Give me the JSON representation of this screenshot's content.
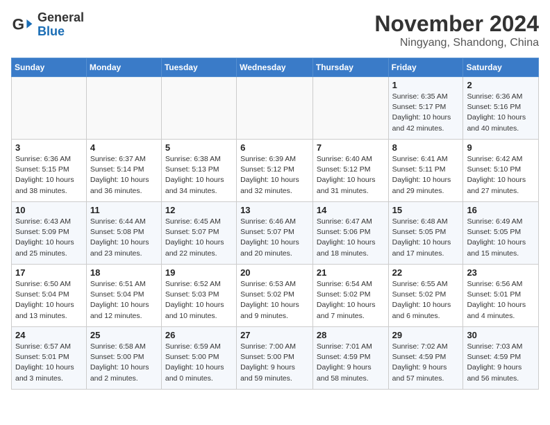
{
  "header": {
    "logo_general": "General",
    "logo_blue": "Blue",
    "month_title": "November 2024",
    "location": "Ningyang, Shandong, China"
  },
  "weekdays": [
    "Sunday",
    "Monday",
    "Tuesday",
    "Wednesday",
    "Thursday",
    "Friday",
    "Saturday"
  ],
  "weeks": [
    [
      {
        "day": "",
        "info": ""
      },
      {
        "day": "",
        "info": ""
      },
      {
        "day": "",
        "info": ""
      },
      {
        "day": "",
        "info": ""
      },
      {
        "day": "",
        "info": ""
      },
      {
        "day": "1",
        "info": "Sunrise: 6:35 AM\nSunset: 5:17 PM\nDaylight: 10 hours and 42 minutes."
      },
      {
        "day": "2",
        "info": "Sunrise: 6:36 AM\nSunset: 5:16 PM\nDaylight: 10 hours and 40 minutes."
      }
    ],
    [
      {
        "day": "3",
        "info": "Sunrise: 6:36 AM\nSunset: 5:15 PM\nDaylight: 10 hours and 38 minutes."
      },
      {
        "day": "4",
        "info": "Sunrise: 6:37 AM\nSunset: 5:14 PM\nDaylight: 10 hours and 36 minutes."
      },
      {
        "day": "5",
        "info": "Sunrise: 6:38 AM\nSunset: 5:13 PM\nDaylight: 10 hours and 34 minutes."
      },
      {
        "day": "6",
        "info": "Sunrise: 6:39 AM\nSunset: 5:12 PM\nDaylight: 10 hours and 32 minutes."
      },
      {
        "day": "7",
        "info": "Sunrise: 6:40 AM\nSunset: 5:12 PM\nDaylight: 10 hours and 31 minutes."
      },
      {
        "day": "8",
        "info": "Sunrise: 6:41 AM\nSunset: 5:11 PM\nDaylight: 10 hours and 29 minutes."
      },
      {
        "day": "9",
        "info": "Sunrise: 6:42 AM\nSunset: 5:10 PM\nDaylight: 10 hours and 27 minutes."
      }
    ],
    [
      {
        "day": "10",
        "info": "Sunrise: 6:43 AM\nSunset: 5:09 PM\nDaylight: 10 hours and 25 minutes."
      },
      {
        "day": "11",
        "info": "Sunrise: 6:44 AM\nSunset: 5:08 PM\nDaylight: 10 hours and 23 minutes."
      },
      {
        "day": "12",
        "info": "Sunrise: 6:45 AM\nSunset: 5:07 PM\nDaylight: 10 hours and 22 minutes."
      },
      {
        "day": "13",
        "info": "Sunrise: 6:46 AM\nSunset: 5:07 PM\nDaylight: 10 hours and 20 minutes."
      },
      {
        "day": "14",
        "info": "Sunrise: 6:47 AM\nSunset: 5:06 PM\nDaylight: 10 hours and 18 minutes."
      },
      {
        "day": "15",
        "info": "Sunrise: 6:48 AM\nSunset: 5:05 PM\nDaylight: 10 hours and 17 minutes."
      },
      {
        "day": "16",
        "info": "Sunrise: 6:49 AM\nSunset: 5:05 PM\nDaylight: 10 hours and 15 minutes."
      }
    ],
    [
      {
        "day": "17",
        "info": "Sunrise: 6:50 AM\nSunset: 5:04 PM\nDaylight: 10 hours and 13 minutes."
      },
      {
        "day": "18",
        "info": "Sunrise: 6:51 AM\nSunset: 5:04 PM\nDaylight: 10 hours and 12 minutes."
      },
      {
        "day": "19",
        "info": "Sunrise: 6:52 AM\nSunset: 5:03 PM\nDaylight: 10 hours and 10 minutes."
      },
      {
        "day": "20",
        "info": "Sunrise: 6:53 AM\nSunset: 5:02 PM\nDaylight: 10 hours and 9 minutes."
      },
      {
        "day": "21",
        "info": "Sunrise: 6:54 AM\nSunset: 5:02 PM\nDaylight: 10 hours and 7 minutes."
      },
      {
        "day": "22",
        "info": "Sunrise: 6:55 AM\nSunset: 5:02 PM\nDaylight: 10 hours and 6 minutes."
      },
      {
        "day": "23",
        "info": "Sunrise: 6:56 AM\nSunset: 5:01 PM\nDaylight: 10 hours and 4 minutes."
      }
    ],
    [
      {
        "day": "24",
        "info": "Sunrise: 6:57 AM\nSunset: 5:01 PM\nDaylight: 10 hours and 3 minutes."
      },
      {
        "day": "25",
        "info": "Sunrise: 6:58 AM\nSunset: 5:00 PM\nDaylight: 10 hours and 2 minutes."
      },
      {
        "day": "26",
        "info": "Sunrise: 6:59 AM\nSunset: 5:00 PM\nDaylight: 10 hours and 0 minutes."
      },
      {
        "day": "27",
        "info": "Sunrise: 7:00 AM\nSunset: 5:00 PM\nDaylight: 9 hours and 59 minutes."
      },
      {
        "day": "28",
        "info": "Sunrise: 7:01 AM\nSunset: 4:59 PM\nDaylight: 9 hours and 58 minutes."
      },
      {
        "day": "29",
        "info": "Sunrise: 7:02 AM\nSunset: 4:59 PM\nDaylight: 9 hours and 57 minutes."
      },
      {
        "day": "30",
        "info": "Sunrise: 7:03 AM\nSunset: 4:59 PM\nDaylight: 9 hours and 56 minutes."
      }
    ]
  ]
}
